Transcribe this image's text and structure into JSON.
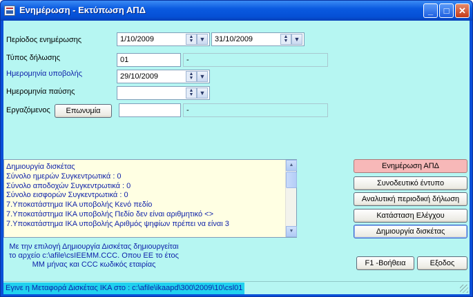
{
  "window": {
    "title": "Ενημέρωση - Εκτύπωση ΑΠΔ",
    "minimize": "_",
    "maximize": "□",
    "close": "✕"
  },
  "form": {
    "period_label": "Περίοδος ενημέρωσης",
    "period_from": "1/10/2009",
    "period_to": "31/10/2009",
    "declaration_type_label": "Τύπος δήλωσης",
    "declaration_type_value": "01",
    "declaration_type_desc": "-",
    "submission_date_label": "Ημερομηνία υποβολής",
    "submission_date_value": "29/10/2009",
    "termination_date_label": "Ημερομηνία παύσης",
    "termination_date_value": "",
    "employee_label": "Εργαζόμενος",
    "surname_button": "Επωνυμία",
    "employee_value": "",
    "employee_desc": "-"
  },
  "log": {
    "lines": [
      "Δημιουργία δισκέτας",
      "Σύνολο ημερών Συγκεντρωτικά : 0",
      "Σύνολο αποδοχών Συγκεντρωτικά : 0",
      "Σύνολο εισφορών Συγκεντρωτικά : 0",
      "7.Υποκατάστημα ΙΚΑ υποβολής Κενό πεδίο",
      "7.Υποκατάστημα ΙΚΑ υποβολής Πεδίο δεν είναι αριθμητικό <>",
      "7.Υποκατάστημα ΙΚΑ υποβολής Αριθμός ψηφίων πρέπει να είναι 3"
    ]
  },
  "info": {
    "line1": "Με την επιλογή Δημιουργία Δισκέτας δημιουργείται",
    "line2": "το αρχείο c:\\afile\\csIEEMM.CCC. Οπου ΕΕ το έτος",
    "line3": "ΜΜ μήνας και CCC κωδικός εταιρίας"
  },
  "actions": {
    "update_apd": "Ενημέρωση ΑΠΔ",
    "cover_form": "Συνοδευτικό έντυπο",
    "analytic_declaration": "Αναλυτική περιοδική δήλωση",
    "check_status": "Κατάσταση Ελέγχου",
    "create_diskette": "Δημιουργία δισκέτας",
    "help": "F1 -Βοήθεια",
    "exit": "Εξοδος"
  },
  "status": {
    "text": "Εγινε η Μεταφορά Δισκέτας ΙΚΑ στο : c:\\afile\\ikaapd\\300\\2009\\10\\csl01"
  },
  "colors": {
    "client_bg": "#b6f6f2",
    "title_bar": "#0a5ae0",
    "log_bg": "#ffffe3",
    "status_highlight": "#21d1ee",
    "update_button": "#f7b8b8"
  }
}
